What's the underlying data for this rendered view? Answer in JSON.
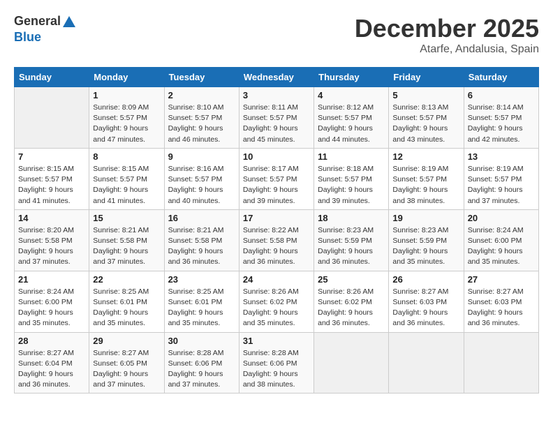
{
  "logo": {
    "text_general": "General",
    "text_blue": "Blue"
  },
  "header": {
    "month": "December 2025",
    "location": "Atarfe, Andalusia, Spain"
  },
  "weekdays": [
    "Sunday",
    "Monday",
    "Tuesday",
    "Wednesday",
    "Thursday",
    "Friday",
    "Saturday"
  ],
  "weeks": [
    [
      {
        "day": "",
        "sunrise": "",
        "sunset": "",
        "daylight": ""
      },
      {
        "day": "1",
        "sunrise": "Sunrise: 8:09 AM",
        "sunset": "Sunset: 5:57 PM",
        "daylight": "Daylight: 9 hours and 47 minutes."
      },
      {
        "day": "2",
        "sunrise": "Sunrise: 8:10 AM",
        "sunset": "Sunset: 5:57 PM",
        "daylight": "Daylight: 9 hours and 46 minutes."
      },
      {
        "day": "3",
        "sunrise": "Sunrise: 8:11 AM",
        "sunset": "Sunset: 5:57 PM",
        "daylight": "Daylight: 9 hours and 45 minutes."
      },
      {
        "day": "4",
        "sunrise": "Sunrise: 8:12 AM",
        "sunset": "Sunset: 5:57 PM",
        "daylight": "Daylight: 9 hours and 44 minutes."
      },
      {
        "day": "5",
        "sunrise": "Sunrise: 8:13 AM",
        "sunset": "Sunset: 5:57 PM",
        "daylight": "Daylight: 9 hours and 43 minutes."
      },
      {
        "day": "6",
        "sunrise": "Sunrise: 8:14 AM",
        "sunset": "Sunset: 5:57 PM",
        "daylight": "Daylight: 9 hours and 42 minutes."
      }
    ],
    [
      {
        "day": "7",
        "sunrise": "Sunrise: 8:15 AM",
        "sunset": "Sunset: 5:57 PM",
        "daylight": "Daylight: 9 hours and 41 minutes."
      },
      {
        "day": "8",
        "sunrise": "Sunrise: 8:15 AM",
        "sunset": "Sunset: 5:57 PM",
        "daylight": "Daylight: 9 hours and 41 minutes."
      },
      {
        "day": "9",
        "sunrise": "Sunrise: 8:16 AM",
        "sunset": "Sunset: 5:57 PM",
        "daylight": "Daylight: 9 hours and 40 minutes."
      },
      {
        "day": "10",
        "sunrise": "Sunrise: 8:17 AM",
        "sunset": "Sunset: 5:57 PM",
        "daylight": "Daylight: 9 hours and 39 minutes."
      },
      {
        "day": "11",
        "sunrise": "Sunrise: 8:18 AM",
        "sunset": "Sunset: 5:57 PM",
        "daylight": "Daylight: 9 hours and 39 minutes."
      },
      {
        "day": "12",
        "sunrise": "Sunrise: 8:19 AM",
        "sunset": "Sunset: 5:57 PM",
        "daylight": "Daylight: 9 hours and 38 minutes."
      },
      {
        "day": "13",
        "sunrise": "Sunrise: 8:19 AM",
        "sunset": "Sunset: 5:57 PM",
        "daylight": "Daylight: 9 hours and 37 minutes."
      }
    ],
    [
      {
        "day": "14",
        "sunrise": "Sunrise: 8:20 AM",
        "sunset": "Sunset: 5:58 PM",
        "daylight": "Daylight: 9 hours and 37 minutes."
      },
      {
        "day": "15",
        "sunrise": "Sunrise: 8:21 AM",
        "sunset": "Sunset: 5:58 PM",
        "daylight": "Daylight: 9 hours and 37 minutes."
      },
      {
        "day": "16",
        "sunrise": "Sunrise: 8:21 AM",
        "sunset": "Sunset: 5:58 PM",
        "daylight": "Daylight: 9 hours and 36 minutes."
      },
      {
        "day": "17",
        "sunrise": "Sunrise: 8:22 AM",
        "sunset": "Sunset: 5:58 PM",
        "daylight": "Daylight: 9 hours and 36 minutes."
      },
      {
        "day": "18",
        "sunrise": "Sunrise: 8:23 AM",
        "sunset": "Sunset: 5:59 PM",
        "daylight": "Daylight: 9 hours and 36 minutes."
      },
      {
        "day": "19",
        "sunrise": "Sunrise: 8:23 AM",
        "sunset": "Sunset: 5:59 PM",
        "daylight": "Daylight: 9 hours and 35 minutes."
      },
      {
        "day": "20",
        "sunrise": "Sunrise: 8:24 AM",
        "sunset": "Sunset: 6:00 PM",
        "daylight": "Daylight: 9 hours and 35 minutes."
      }
    ],
    [
      {
        "day": "21",
        "sunrise": "Sunrise: 8:24 AM",
        "sunset": "Sunset: 6:00 PM",
        "daylight": "Daylight: 9 hours and 35 minutes."
      },
      {
        "day": "22",
        "sunrise": "Sunrise: 8:25 AM",
        "sunset": "Sunset: 6:01 PM",
        "daylight": "Daylight: 9 hours and 35 minutes."
      },
      {
        "day": "23",
        "sunrise": "Sunrise: 8:25 AM",
        "sunset": "Sunset: 6:01 PM",
        "daylight": "Daylight: 9 hours and 35 minutes."
      },
      {
        "day": "24",
        "sunrise": "Sunrise: 8:26 AM",
        "sunset": "Sunset: 6:02 PM",
        "daylight": "Daylight: 9 hours and 35 minutes."
      },
      {
        "day": "25",
        "sunrise": "Sunrise: 8:26 AM",
        "sunset": "Sunset: 6:02 PM",
        "daylight": "Daylight: 9 hours and 36 minutes."
      },
      {
        "day": "26",
        "sunrise": "Sunrise: 8:27 AM",
        "sunset": "Sunset: 6:03 PM",
        "daylight": "Daylight: 9 hours and 36 minutes."
      },
      {
        "day": "27",
        "sunrise": "Sunrise: 8:27 AM",
        "sunset": "Sunset: 6:03 PM",
        "daylight": "Daylight: 9 hours and 36 minutes."
      }
    ],
    [
      {
        "day": "28",
        "sunrise": "Sunrise: 8:27 AM",
        "sunset": "Sunset: 6:04 PM",
        "daylight": "Daylight: 9 hours and 36 minutes."
      },
      {
        "day": "29",
        "sunrise": "Sunrise: 8:27 AM",
        "sunset": "Sunset: 6:05 PM",
        "daylight": "Daylight: 9 hours and 37 minutes."
      },
      {
        "day": "30",
        "sunrise": "Sunrise: 8:28 AM",
        "sunset": "Sunset: 6:06 PM",
        "daylight": "Daylight: 9 hours and 37 minutes."
      },
      {
        "day": "31",
        "sunrise": "Sunrise: 8:28 AM",
        "sunset": "Sunset: 6:06 PM",
        "daylight": "Daylight: 9 hours and 38 minutes."
      },
      {
        "day": "",
        "sunrise": "",
        "sunset": "",
        "daylight": ""
      },
      {
        "day": "",
        "sunrise": "",
        "sunset": "",
        "daylight": ""
      },
      {
        "day": "",
        "sunrise": "",
        "sunset": "",
        "daylight": ""
      }
    ]
  ]
}
